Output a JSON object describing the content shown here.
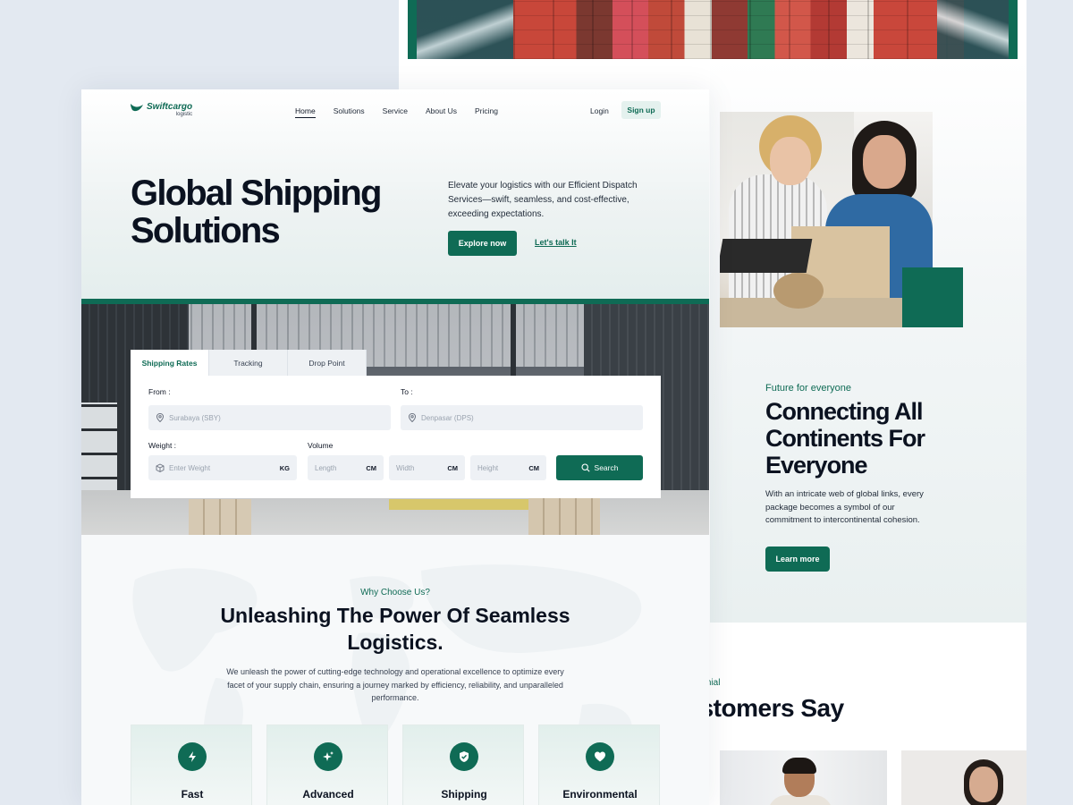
{
  "colors": {
    "brand": "#0f6b55",
    "background": "#e3e9f1",
    "text": "#0b1220"
  },
  "brand": {
    "name": "Swiftcargo",
    "subtitle": "logistic"
  },
  "nav": {
    "links": [
      "Home",
      "Solutions",
      "Service",
      "About Us",
      "Pricing"
    ],
    "active": "Home",
    "login": "Login",
    "signup": "Sign up"
  },
  "hero": {
    "title": "Global Shipping Solutions",
    "description": "Elevate your logistics with our Efficient Dispatch Services—swift, seamless, and cost-effective, exceeding expectations.",
    "primary_cta": "Explore now",
    "secondary_cta": "Let's talk It"
  },
  "shipping_widget": {
    "tabs": [
      "Shipping Rates",
      "Tracking",
      "Drop Point"
    ],
    "active_tab": "Shipping Rates",
    "from_label": "From :",
    "from_placeholder": "Surabaya (SBY)",
    "to_label": "To :",
    "to_placeholder": "Denpasar (DPS)",
    "weight_label": "Weight :",
    "weight_placeholder": "Enter Weight",
    "weight_unit": "KG",
    "volume_label": "Volume",
    "length_placeholder": "Length",
    "width_placeholder": "Width",
    "height_placeholder": "Height",
    "dimension_unit": "CM",
    "search_button": "Search"
  },
  "why": {
    "eyebrow": "Why Choose Us?",
    "title": "Unleashing The Power Of Seamless Logistics.",
    "description": "We unleash the power of cutting-edge technology and operational excellence to optimize every facet of your supply chain, ensuring a journey marked by efficiency, reliability, and unparalleled performance.",
    "features": [
      {
        "label": "Fast",
        "icon": "bolt-icon"
      },
      {
        "label": "Advanced",
        "icon": "sparkle-icon"
      },
      {
        "label": "Shipping",
        "icon": "shield-check-icon"
      },
      {
        "label": "Environmental",
        "icon": "heart-icon"
      }
    ]
  },
  "connect": {
    "eyebrow": "Future for everyone",
    "title": "Connecting All Continents For Everyone",
    "description": "With an intricate web of global links, every package becomes a symbol of our commitment to intercontinental cohesion.",
    "cta": "Learn more"
  },
  "testimonial": {
    "eyebrow": "monial",
    "title": "ustomers Say"
  }
}
